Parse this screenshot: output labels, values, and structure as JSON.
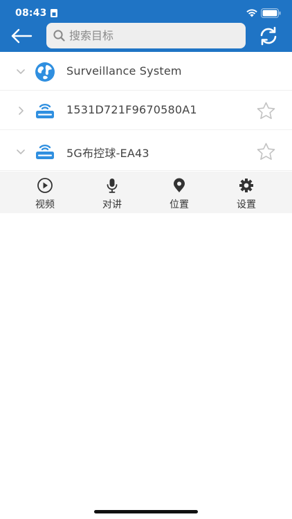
{
  "status_bar": {
    "time": "08:43"
  },
  "header": {
    "search": {
      "placeholder": "搜索目标",
      "value": ""
    }
  },
  "tree": {
    "items": [
      {
        "label": "Surveillance System",
        "expanded": true,
        "icon": "globe-icon"
      },
      {
        "label": "1531D721F9670580A1",
        "expanded": false,
        "icon": "router-icon",
        "favorite": false
      },
      {
        "label": "5G布控球-EA43",
        "expanded": true,
        "icon": "router-icon",
        "favorite": false
      }
    ]
  },
  "actions": {
    "items": [
      {
        "label": "视频",
        "icon": "play-icon"
      },
      {
        "label": "对讲",
        "icon": "microphone-icon"
      },
      {
        "label": "位置",
        "icon": "location-pin-icon"
      },
      {
        "label": "设置",
        "icon": "gear-icon"
      }
    ]
  },
  "colors": {
    "header": "#1f74c5",
    "icon_blue": "#2f8fe0",
    "star": "#c2c2c2",
    "action_bar": "#f4f4f4"
  }
}
